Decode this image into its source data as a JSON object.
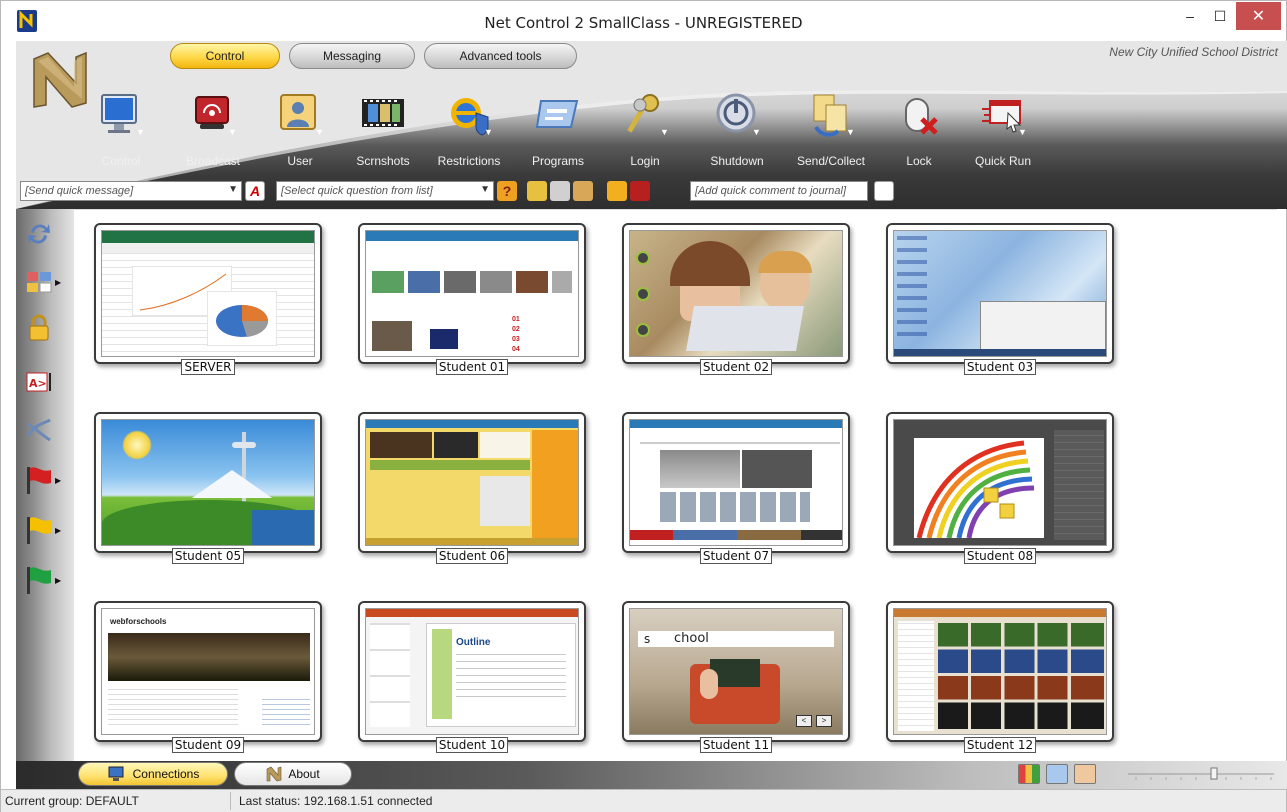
{
  "window": {
    "title": "Net Control 2 SmallClass - UNREGISTERED"
  },
  "ribbon": {
    "tabs": [
      {
        "label": "Control",
        "active": true
      },
      {
        "label": "Messaging",
        "active": false
      },
      {
        "label": "Advanced tools",
        "active": false
      }
    ],
    "district": "New City Unified School District",
    "tools": [
      {
        "label": "Control",
        "icon": "monitor-icon",
        "dropdown": true
      },
      {
        "label": "Broadcast",
        "icon": "broadcast-icon",
        "dropdown": true
      },
      {
        "label": "User",
        "icon": "user-icon",
        "dropdown": true
      },
      {
        "label": "Scrnshots",
        "icon": "filmstrip-icon",
        "dropdown": false
      },
      {
        "label": "Restrictions",
        "icon": "ie-shield-icon",
        "dropdown": true
      },
      {
        "label": "Programs",
        "icon": "programs-window-icon",
        "dropdown": false
      },
      {
        "label": "Login",
        "icon": "keys-icon",
        "dropdown": true
      },
      {
        "label": "Shutdown",
        "icon": "power-icon",
        "dropdown": true
      },
      {
        "label": "Send/Collect",
        "icon": "files-transfer-icon",
        "dropdown": true
      },
      {
        "label": "Lock",
        "icon": "mouse-lock-icon",
        "dropdown": false
      },
      {
        "label": "Quick Run",
        "icon": "quick-run-icon",
        "dropdown": true
      }
    ],
    "quick": {
      "message_placeholder": "[Send quick message]",
      "question_placeholder": "[Select quick question from list]",
      "comment_placeholder": "[Add quick comment to journal]"
    }
  },
  "students": [
    {
      "label": "SERVER"
    },
    {
      "label": "Student 01"
    },
    {
      "label": "Student 02"
    },
    {
      "label": "Student 03"
    },
    {
      "label": "Student 05"
    },
    {
      "label": "Student 06"
    },
    {
      "label": "Student 07"
    },
    {
      "label": "Student 08"
    },
    {
      "label": "Student 09"
    },
    {
      "label": "Student 10"
    },
    {
      "label": "Student 11"
    },
    {
      "label": "Student 12"
    }
  ],
  "thumbs": {
    "webforschools": "webforschools",
    "outline": "Outline",
    "school_word": "chool",
    "school_letter": "s"
  },
  "bottom": {
    "tabs": [
      {
        "label": "Connections",
        "active": true
      },
      {
        "label": "About",
        "active": false
      }
    ]
  },
  "status": {
    "group": "Current group: DEFAULT",
    "last": "Last status: 192.168.1.51 connected"
  }
}
